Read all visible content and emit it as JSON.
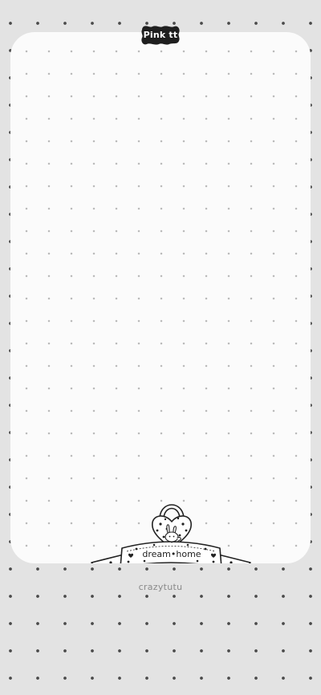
{
  "badge": {
    "label": "Pink tt"
  },
  "hanger": {
    "label": "dream•home"
  },
  "footer": {
    "credit": "crazytutu"
  },
  "colors": {
    "background": "#e3e3e3",
    "card": "#fbfbfb",
    "ink": "#222222",
    "credit": "#8a8a8a"
  },
  "icons": [
    "bow-badge-icon",
    "heart-lock-icon",
    "bunny-icon",
    "ribbon-banner-icon"
  ]
}
